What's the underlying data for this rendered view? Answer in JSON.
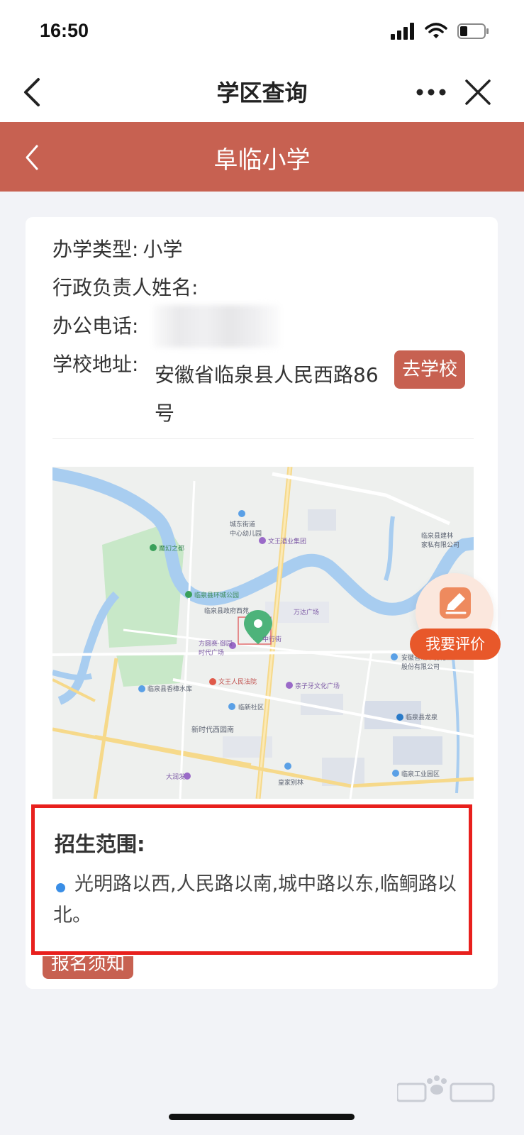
{
  "status_bar": {
    "time": "16:50"
  },
  "nav": {
    "title": "学区查询"
  },
  "school": {
    "name": "阜临小学"
  },
  "info": {
    "type_label": "办学类型:",
    "type_value": "小学",
    "admin_label": "行政负责人姓名:",
    "phone_label": "办公电话:",
    "address_label": "学校地址:",
    "address_value": "安徽省临泉县人民西路86号",
    "go_school_label": "去学校"
  },
  "map": {
    "labels": {
      "l1": "城东街道\n中心幼儿园",
      "l2": "文王酒业集团",
      "l3": "魔幻之都",
      "l4": "临泉县环城公园",
      "l5": "临泉县政府西苑",
      "l6": "万达广场",
      "l7": "方圆赛·御园\n时代广场",
      "l8": "文王人民法院",
      "l9": "亲子牙文化广场",
      "l10": "临泉县香樟水库",
      "l11": "临新社区",
      "l12": "新时代西园南",
      "l13": "大润发",
      "l14": "皇家别林",
      "l15": "临泉工业园区",
      "l16": "安徽省煤中能化工\n股份有限公司",
      "l17": "临泉县建林\n家私有限公司",
      "l18": "临泉县龙泉",
      "l19": "中行街"
    }
  },
  "rate": {
    "label": "我要评价"
  },
  "scope": {
    "title": "招生范围:",
    "text": "光明路以西,人民路以南,城中路以东,临鲖路以北。"
  },
  "signup": {
    "label": "报名须知"
  },
  "colors": {
    "header": "#c76151",
    "highlight": "#e8201d",
    "rate_button": "#e8582a",
    "bullet": "#3a8ee6"
  }
}
